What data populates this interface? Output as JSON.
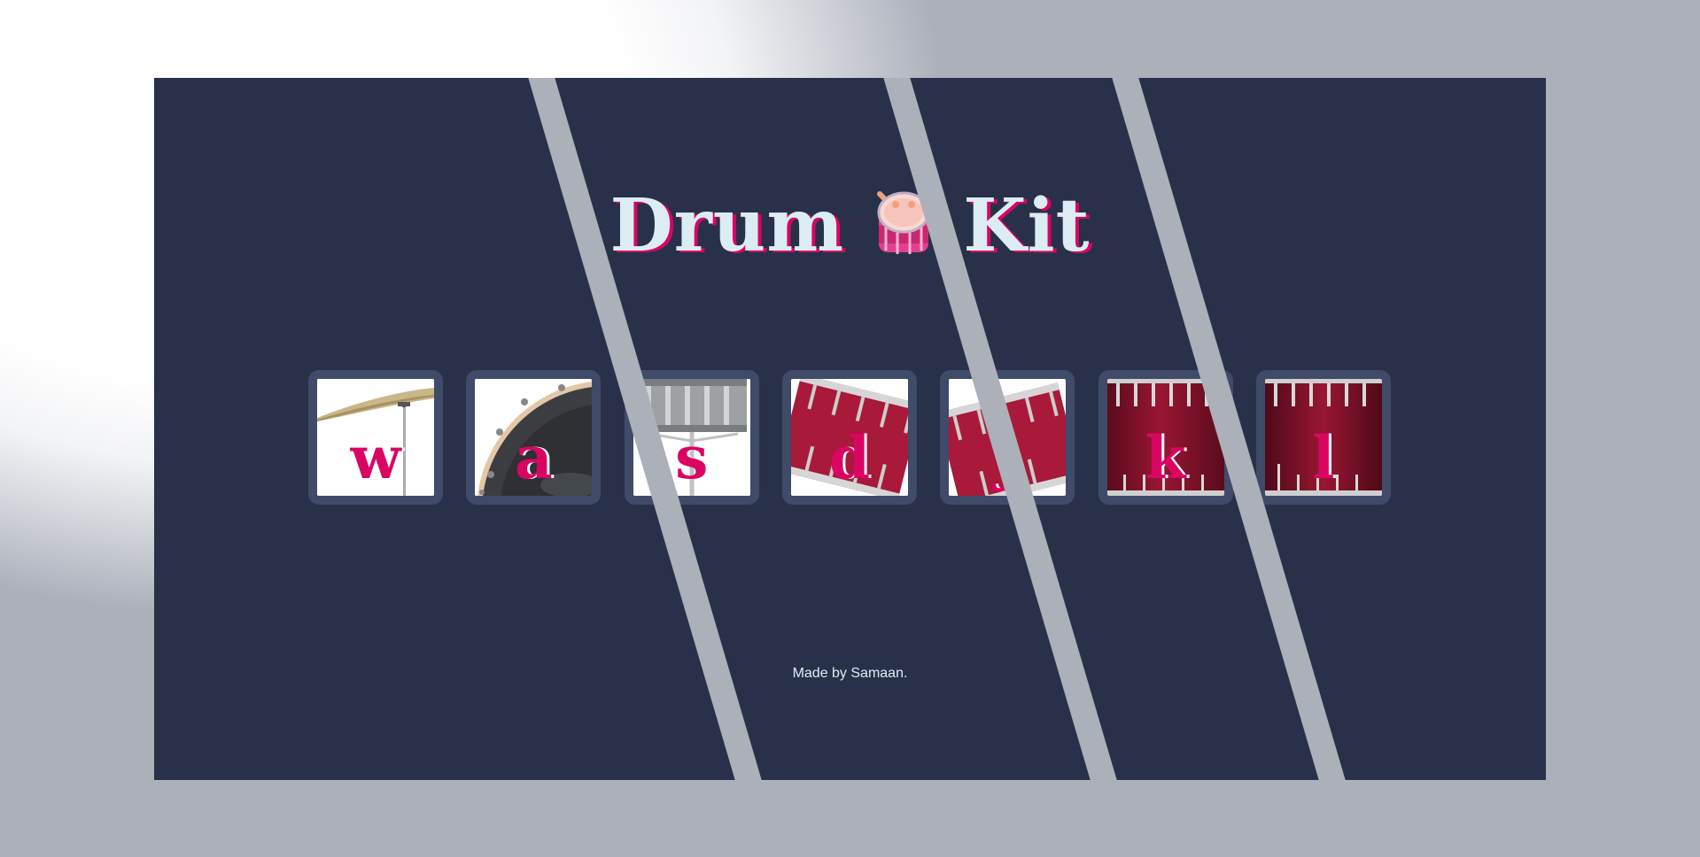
{
  "page": {
    "title_word_1": "Drum",
    "title_word_2": "Kit",
    "title_icon": "drum-emoji-icon",
    "footer": "Made by Samaan."
  },
  "drums": [
    {
      "key": "w",
      "icon": "crash-cymbal-icon"
    },
    {
      "key": "a",
      "icon": "kick-drum-icon"
    },
    {
      "key": "s",
      "icon": "snare-drum-icon"
    },
    {
      "key": "d",
      "icon": "tom-drum-icon"
    },
    {
      "key": "j",
      "icon": "tom-drum-icon"
    },
    {
      "key": "k",
      "icon": "floor-tom-icon"
    },
    {
      "key": "l",
      "icon": "floor-tom-icon"
    }
  ],
  "colors": {
    "panel_background": "#283149",
    "key_letter": "#da0463",
    "title_text": "#dbedf3",
    "button_border": "#404b69",
    "stripe": "#acb0b9"
  }
}
